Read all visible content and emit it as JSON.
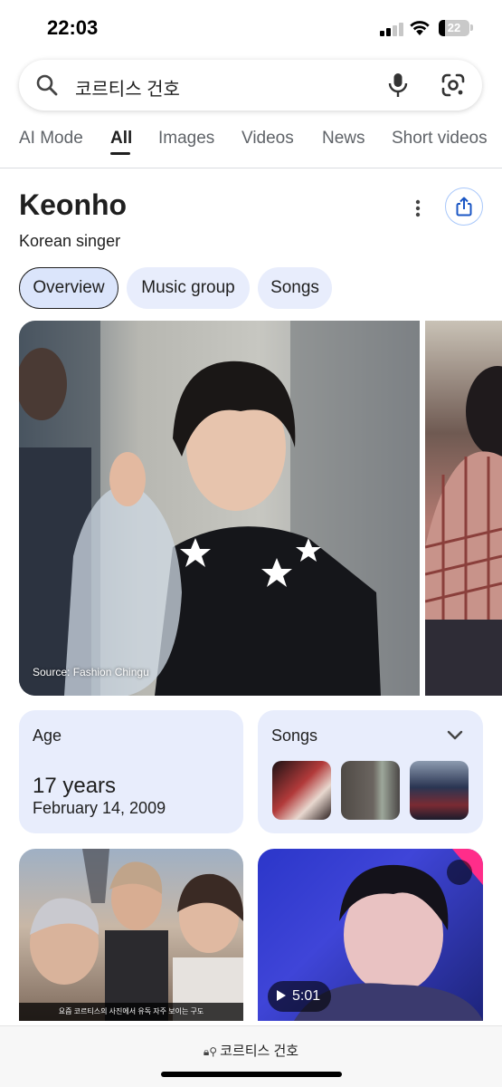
{
  "status_bar": {
    "time": "22:03",
    "battery": "22",
    "battery_level": 0.22
  },
  "search": {
    "query": "코르티스 건호",
    "icons": [
      "search-icon",
      "mic-icon",
      "lens-icon"
    ]
  },
  "tabs": [
    {
      "label": "AI Mode",
      "active": false
    },
    {
      "label": "All",
      "active": true
    },
    {
      "label": "Images",
      "active": false
    },
    {
      "label": "Videos",
      "active": false
    },
    {
      "label": "News",
      "active": false
    },
    {
      "label": "Short videos",
      "active": false
    }
  ],
  "entity": {
    "title": "Keonho",
    "subtitle": "Korean singer"
  },
  "chips": [
    {
      "label": "Overview",
      "selected": true
    },
    {
      "label": "Music group",
      "selected": false
    },
    {
      "label": "Songs",
      "selected": false
    }
  ],
  "image": {
    "source": "Source: Fashion Chingu"
  },
  "age_card": {
    "label": "Age",
    "value": "17 years",
    "date": "February 14, 2009"
  },
  "songs_card": {
    "label": "Songs"
  },
  "thumbnails": {
    "left_caption": "요즘 코르티스의 사진에서 유독 자주 보이는 구도",
    "video_duration": "5:01"
  },
  "url_bar": {
    "text": "코르티스 건호"
  },
  "colors": {
    "accent_chip": "#e8edfc",
    "card_bg": "#e8edfc",
    "share_border": "#a8c7fa"
  }
}
